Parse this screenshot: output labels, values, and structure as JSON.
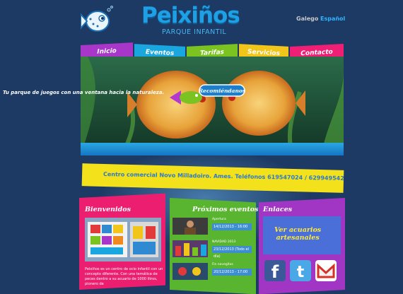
{
  "header": {
    "logo_title": "Peixiños",
    "logo_subtitle": "PARQUE INFANTIL",
    "lang_gl": "Galego",
    "lang_es": "Español"
  },
  "nav": {
    "items": [
      "Inicio",
      "Eventos",
      "Tarifas",
      "Servicios",
      "Contacto"
    ]
  },
  "banner": {
    "caption": "Tu parque de juegos con una ventana hacia la naturaleza.",
    "badge": "Recomiéndanos"
  },
  "info_bar": {
    "text": "Centro comercial Novo Milladoiro. Ames. Teléfonos 619547024 / 629949542"
  },
  "columns": {
    "bienvenidos": {
      "title": "Bienvenidos",
      "text": "Peixiños es un centro de ocio infantil con un concepto diferente. Con una temática de peces dentro a su acuario de 1000 litros, pionero de"
    },
    "eventos": {
      "title": "Próximos eventos",
      "items": [
        {
          "label": "Apertura",
          "date": "14/12/2013 - 16:00"
        },
        {
          "label": "NAVIDAD 2013",
          "date": "23/12/2013 (Todo el día)"
        },
        {
          "label": "Fin navegitos",
          "date": "20/12/2013 - 17:00"
        }
      ]
    },
    "enlaces": {
      "title": "Enlaces",
      "box_line1": "Ver acuarios",
      "box_line2": "artesanales",
      "social_icons": [
        "facebook-icon",
        "twitter-icon",
        "gmail-icon"
      ]
    }
  },
  "colors": {
    "background": "#1d3a64",
    "purple": "#a836c9",
    "blue": "#1aa7e0",
    "green": "#7ac320",
    "yellow": "#f2c51a",
    "pink": "#ee1f75"
  }
}
